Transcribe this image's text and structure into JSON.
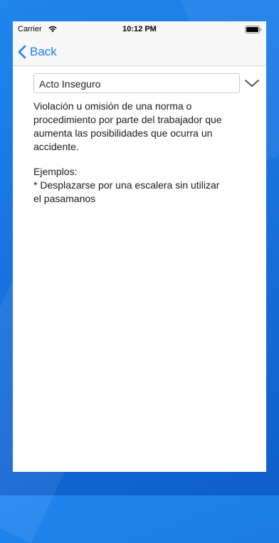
{
  "status_bar": {
    "carrier": "Carrier",
    "time": "10:12 PM",
    "wifi_icon": "wifi-icon",
    "battery_icon": "battery-icon"
  },
  "nav": {
    "back_label": "Back",
    "back_icon": "chevron-left-icon"
  },
  "selector": {
    "selected_value": "Acto Inseguro",
    "dropdown_icon": "chevron-down-icon"
  },
  "content": {
    "description_lines": [
      "Violación u omisión de una norma o",
      "procedimiento por parte del trabajador que",
      "aumenta las posibilidades que ocurra un",
      "accidente."
    ],
    "examples_title": "Ejemplos:",
    "example_lines": [
      "* Desplazarse por una escalera sin utilizar",
      "el pasamanos"
    ]
  },
  "colors": {
    "accent": "#1f7cf2",
    "background_blue": "#1873de"
  }
}
